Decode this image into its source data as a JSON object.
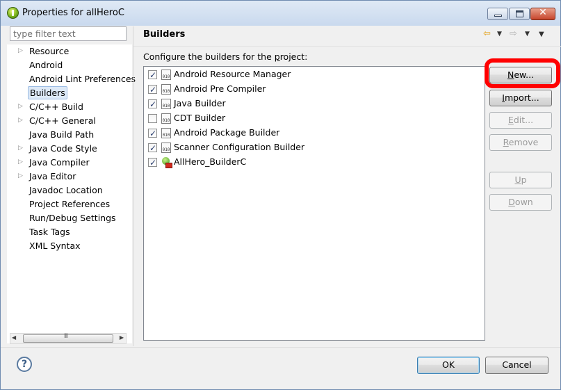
{
  "window": {
    "title": "Properties for allHeroC",
    "controls": {
      "minimize": "minimize",
      "maximize": "maximize",
      "close": "x"
    }
  },
  "filter": {
    "placeholder": "type filter text",
    "value": ""
  },
  "tree": {
    "items": [
      {
        "label": "Resource",
        "expandable": true,
        "selected": false
      },
      {
        "label": "Android",
        "expandable": false,
        "selected": false
      },
      {
        "label": "Android Lint Preferences",
        "expandable": false,
        "selected": false
      },
      {
        "label": "Builders",
        "expandable": false,
        "selected": true
      },
      {
        "label": "C/C++ Build",
        "expandable": true,
        "selected": false
      },
      {
        "label": "C/C++ General",
        "expandable": true,
        "selected": false
      },
      {
        "label": "Java Build Path",
        "expandable": false,
        "selected": false
      },
      {
        "label": "Java Code Style",
        "expandable": true,
        "selected": false
      },
      {
        "label": "Java Compiler",
        "expandable": true,
        "selected": false
      },
      {
        "label": "Java Editor",
        "expandable": true,
        "selected": false
      },
      {
        "label": "Javadoc Location",
        "expandable": false,
        "selected": false
      },
      {
        "label": "Project References",
        "expandable": false,
        "selected": false
      },
      {
        "label": "Run/Debug Settings",
        "expandable": false,
        "selected": false
      },
      {
        "label": "Task Tags",
        "expandable": false,
        "selected": false
      },
      {
        "label": "XML Syntax",
        "expandable": false,
        "selected": false
      }
    ],
    "scrollbar_grip": "III"
  },
  "page": {
    "title": "Builders",
    "description_pre": "Configure the builders for the ",
    "description_mnemonic": "p",
    "description_post": "roject:"
  },
  "builders": [
    {
      "name": "Android Resource Manager",
      "checked": true,
      "icon": "builder-010-icon"
    },
    {
      "name": "Android Pre Compiler",
      "checked": true,
      "icon": "builder-010-icon"
    },
    {
      "name": "Java Builder",
      "checked": true,
      "icon": "builder-010-icon"
    },
    {
      "name": "CDT Builder",
      "checked": false,
      "icon": "builder-010-icon"
    },
    {
      "name": "Android Package Builder",
      "checked": true,
      "icon": "builder-010-icon"
    },
    {
      "name": "Scanner Configuration Builder",
      "checked": true,
      "icon": "builder-010-icon"
    },
    {
      "name": "AllHero_BuilderC",
      "checked": true,
      "icon": "external-tool-builder-icon"
    }
  ],
  "builder_icon_text": "010",
  "buttons": {
    "new": {
      "mnemonic": "N",
      "rest": "ew...",
      "enabled": true
    },
    "import": {
      "mnemonic": "I",
      "rest": "mport...",
      "enabled": true
    },
    "edit": {
      "mnemonic": "E",
      "rest": "dit...",
      "enabled": false
    },
    "remove": {
      "mnemonic": "R",
      "rest": "emove",
      "enabled": false
    },
    "up": {
      "mnemonic": "U",
      "rest": "p",
      "enabled": false
    },
    "down": {
      "mnemonic": "D",
      "rest": "own",
      "enabled": false
    }
  },
  "footer": {
    "help_symbol": "?",
    "ok_label": "OK",
    "cancel_label": "Cancel"
  },
  "colors": {
    "highlight_ring": "#ff0000",
    "selection_bg": "#dde9f7",
    "back_arrow": "#e3a21a"
  }
}
